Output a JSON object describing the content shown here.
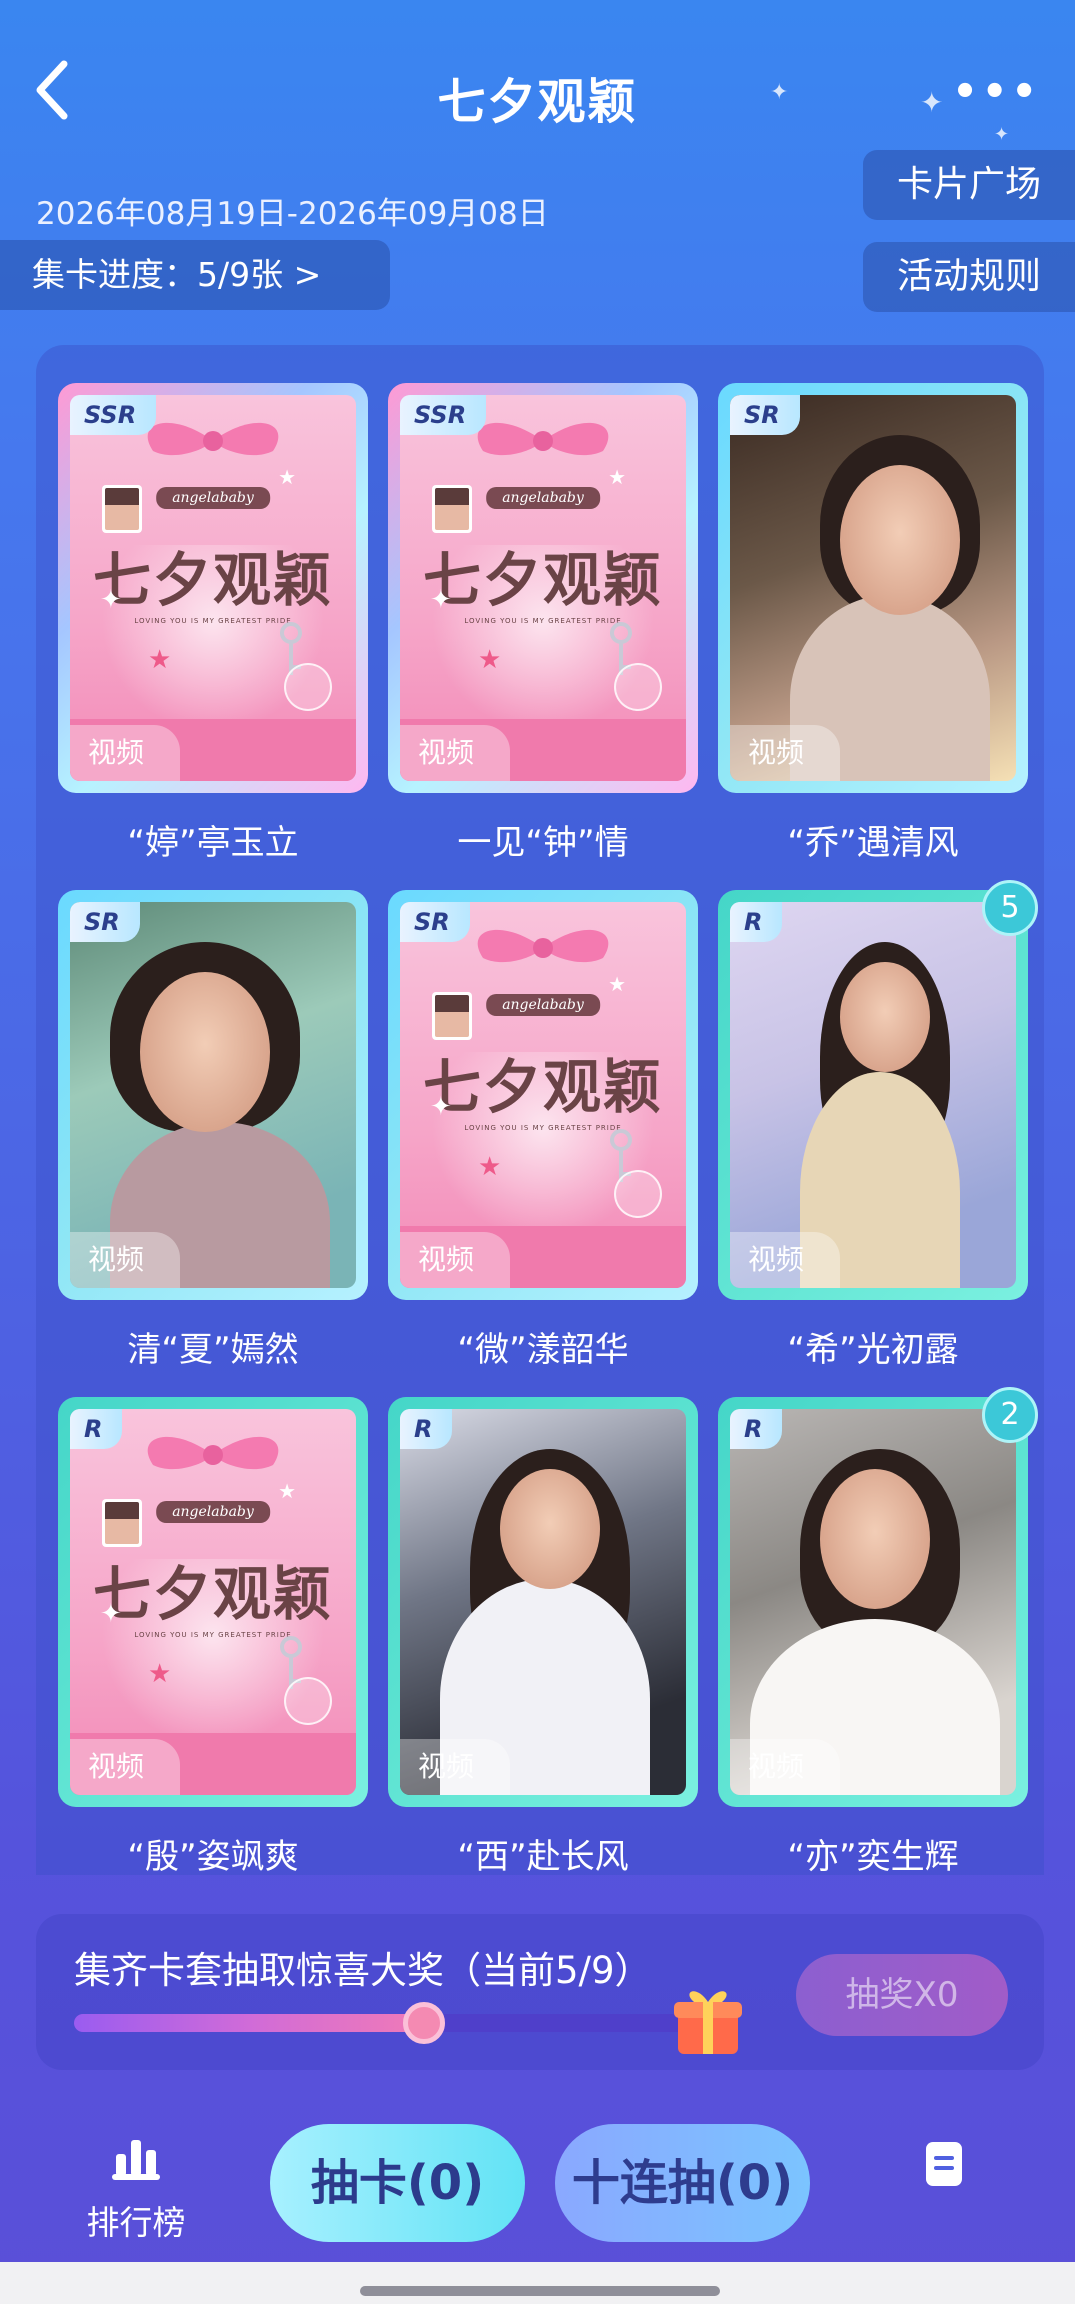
{
  "header": {
    "title": "七夕观颖",
    "date_range": "2026年08月19日-2026年09月08日",
    "progress_label": "集卡进度：5/9张 >",
    "card_square": "卡片广场",
    "event_rules": "活动规则"
  },
  "cards": [
    {
      "rarity": "SSR",
      "name": "“婷”亭玉立",
      "tag": "视频",
      "kind": "poster",
      "count": ""
    },
    {
      "rarity": "SSR",
      "name": "一见“钟”情",
      "tag": "视频",
      "kind": "poster",
      "count": ""
    },
    {
      "rarity": "SR",
      "name": "“乔”遇清风",
      "tag": "视频",
      "kind": "photo",
      "count": ""
    },
    {
      "rarity": "SR",
      "name": "清“夏”嫣然",
      "tag": "视频",
      "kind": "photo",
      "count": ""
    },
    {
      "rarity": "SR",
      "name": "“微”漾韶华",
      "tag": "视频",
      "kind": "poster",
      "count": ""
    },
    {
      "rarity": "R",
      "name": "“希”光初露",
      "tag": "视频",
      "kind": "photo",
      "count": "5"
    },
    {
      "rarity": "R",
      "name": "“殷”姿飒爽",
      "tag": "视频",
      "kind": "poster",
      "count": ""
    },
    {
      "rarity": "R",
      "name": "“西”赴长风",
      "tag": "视频",
      "kind": "photo",
      "count": ""
    },
    {
      "rarity": "R",
      "name": "“亦”奕生辉",
      "tag": "视频",
      "kind": "photo",
      "count": "2"
    }
  ],
  "poster": {
    "title": "七夕观颖",
    "brand": "angelababy",
    "tagline": "LOVING YOU IS MY GREATEST PRIDE"
  },
  "reward": {
    "text": "集齐卡套抽取惊喜大奖（当前5/9）",
    "progress": 0.556,
    "button": "抽奖X0"
  },
  "bottom_bar": {
    "rank_label": "排行榜",
    "draw_one": "抽卡(0)",
    "draw_ten": "十连抽(0)"
  },
  "colors": {
    "ssr_frame": "#ff9ad4",
    "sr_frame": "#6ad9ff",
    "r_frame": "#45d6c8",
    "badge": "#3cc8d8"
  }
}
